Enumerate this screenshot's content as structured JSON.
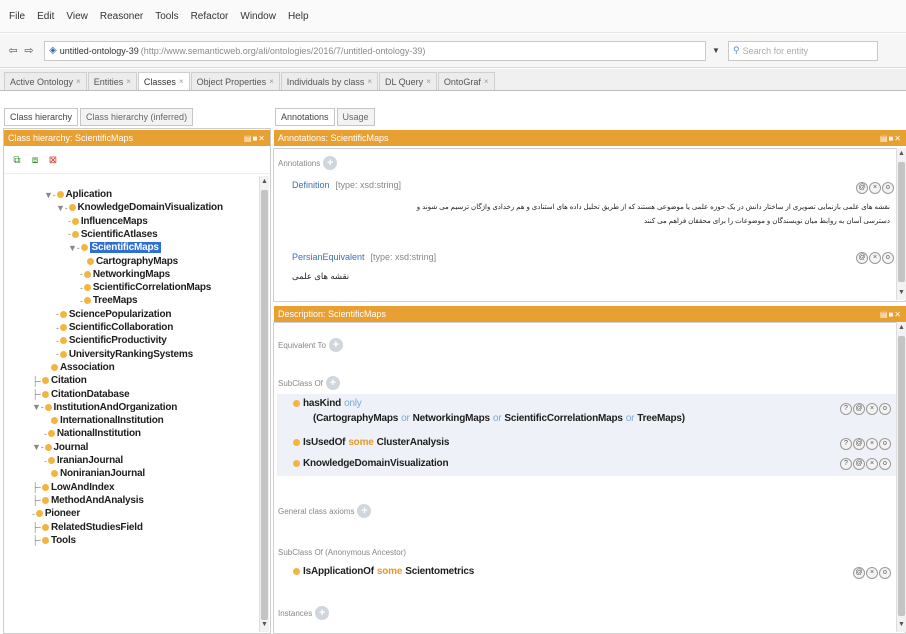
{
  "menu": [
    "File",
    "Edit",
    "View",
    "Reasoner",
    "Tools",
    "Refactor",
    "Window",
    "Help"
  ],
  "address": {
    "back": "⇦",
    "forward": "⇨",
    "ontology_name": "untitled-ontology-39",
    "ontology_uri": "(http://www.semanticweb.org/ali/ontologies/2016/7/untitled-ontology-39)",
    "search_placeholder": "Search for entity"
  },
  "tabs": [
    {
      "label": "Active Ontology",
      "active": false
    },
    {
      "label": "Entities",
      "active": false
    },
    {
      "label": "Classes",
      "active": true
    },
    {
      "label": "Object Properties",
      "active": false
    },
    {
      "label": "Individuals by class",
      "active": false
    },
    {
      "label": "DL Query",
      "active": false
    },
    {
      "label": "OntoGraf",
      "active": false
    }
  ],
  "left": {
    "subtabs": [
      "Class hierarchy",
      "Class hierarchy (inferred)"
    ],
    "header": "Class hierarchy: ScientificMaps",
    "tree": [
      {
        "indent": 1,
        "label": "Aplication",
        "prefix": "▼-"
      },
      {
        "indent": 2,
        "label": "KnowledgeDomainVisualization",
        "prefix": "▼-"
      },
      {
        "indent": 3,
        "label": "InfluenceMaps",
        "prefix": "-"
      },
      {
        "indent": 3,
        "label": "ScientificAtlases",
        "prefix": "-"
      },
      {
        "indent": 3,
        "label": "ScientificMaps",
        "prefix": "▼-",
        "selected": true
      },
      {
        "indent": 4,
        "label": "CartographyMaps",
        "prefix": ""
      },
      {
        "indent": 4,
        "label": "NetworkingMaps",
        "prefix": "-"
      },
      {
        "indent": 4,
        "label": "ScientificCorrelationMaps",
        "prefix": "-"
      },
      {
        "indent": 4,
        "label": "TreeMaps",
        "prefix": "-"
      },
      {
        "indent": 2,
        "label": "SciencePopularization",
        "prefix": "-"
      },
      {
        "indent": 2,
        "label": "ScientificCollaboration",
        "prefix": "-"
      },
      {
        "indent": 2,
        "label": "ScientificProductivity",
        "prefix": "-"
      },
      {
        "indent": 2,
        "label": "UniversityRankingSystems",
        "prefix": "-"
      },
      {
        "indent": 1,
        "label": "Association",
        "prefix": ""
      },
      {
        "indent": 0,
        "label": "Citation",
        "prefix": "├-"
      },
      {
        "indent": 0,
        "label": "CitationDatabase",
        "prefix": "├-"
      },
      {
        "indent": 0,
        "label": "InstitutionAndOrganization",
        "prefix": "▼-"
      },
      {
        "indent": 1,
        "label": "InternationalInstitution",
        "prefix": ""
      },
      {
        "indent": 1,
        "label": "NationalInstitution",
        "prefix": "-"
      },
      {
        "indent": 0,
        "label": "Journal",
        "prefix": "▼-"
      },
      {
        "indent": 1,
        "label": "IranianJournal",
        "prefix": "-"
      },
      {
        "indent": 1,
        "label": "NoniranianJournal",
        "prefix": ""
      },
      {
        "indent": 0,
        "label": "LowAndIndex",
        "prefix": "├-"
      },
      {
        "indent": 0,
        "label": "MethodAndAnalysis",
        "prefix": "├-"
      },
      {
        "indent": 0,
        "label": "Pioneer",
        "prefix": "-"
      },
      {
        "indent": 0,
        "label": "RelatedStudiesField",
        "prefix": "├-"
      },
      {
        "indent": 0,
        "label": "Tools",
        "prefix": "├-"
      }
    ]
  },
  "right": {
    "subtabs": [
      "Annotations",
      "Usage"
    ],
    "annot_header": "Annotations: ScientificMaps",
    "annotations_label": "Annotations",
    "definition_key": "Definition",
    "definition_type": "[type: xsd:string]",
    "definition_text_1": "نقشه های علمی بازنمایی تصویری از ساختار دانش در یک حوزه علمی یا موضوعی هستند که از طریق تحلیل داده های استنادی و هم رخدادی واژگان ترسیم می شوند و",
    "definition_text_2": "دسترسی آسان به روابط میان نویسندگان و موضوعات را برای محققان فراهم می کنند",
    "persian_key": "PersianEquivalent",
    "persian_type": "[type: xsd:string]",
    "persian_text": "نقشه های علمی",
    "desc_header": "Description: ScientificMaps",
    "equivalent_to": "Equivalent To",
    "subclass_of": "SubClass Of",
    "general_axioms": "General class axioms",
    "subclass_anon": "SubClass Of (Anonymous Ancestor)",
    "instances": "Instances",
    "axiom1_prop": "hasKind",
    "axiom1_kw": "only",
    "axiom1_open": "(",
    "axiom1_c1": "CartographyMaps",
    "axiom1_c2": "NetworkingMaps",
    "axiom1_c3": "ScientificCorrelationMaps",
    "axiom1_c4": "TreeMaps",
    "axiom1_close": ")",
    "or_kw": "or",
    "axiom2_prop": "IsUsedOf",
    "axiom2_kw": "some",
    "axiom2_cls": "ClusterAnalysis",
    "axiom3_cls": "KnowledgeDomainVisualization",
    "axiom4_prop": "IsApplicationOf",
    "axiom4_kw": "some",
    "axiom4_cls": "Scientometrics"
  },
  "colors": {
    "header_orange": "#e9a032",
    "class_dot": "#f2b640",
    "keyword_blue": "#7da7d8",
    "selection_blue": "#2f6fd1"
  }
}
